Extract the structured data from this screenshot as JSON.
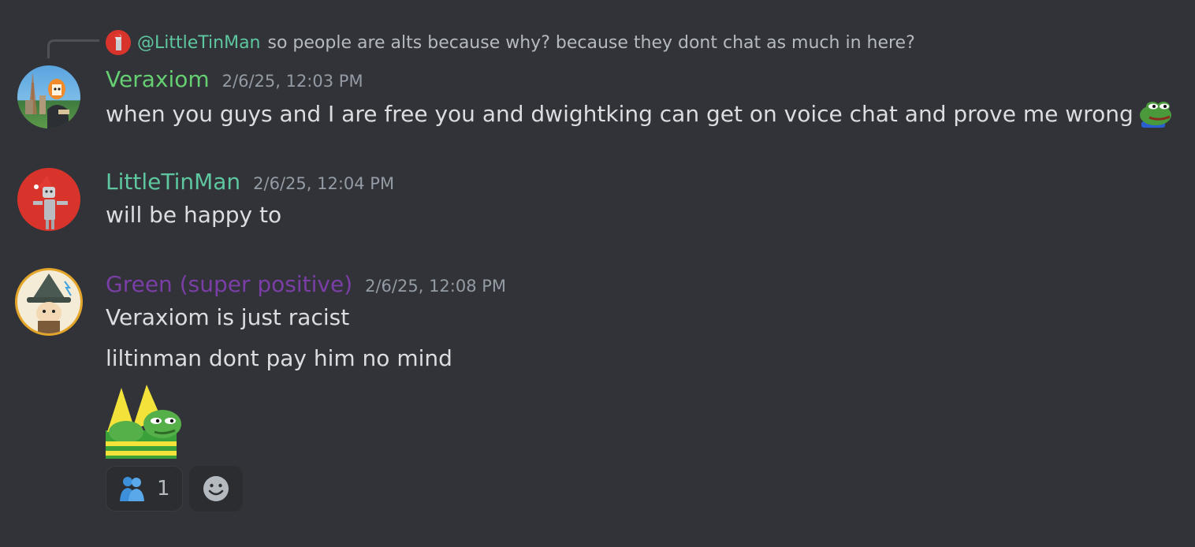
{
  "reply": {
    "mention": "@LittleTinMan",
    "text": "so people are alts because why? because they dont chat as much in here?"
  },
  "messages": [
    {
      "author": "Veraxiom",
      "timestamp": "2/6/25, 12:03 PM",
      "lines": [
        "when you guys and I are free you and dwightking can get on voice chat and prove me wrong"
      ],
      "inline_emoji": "pepe-frog-emoji"
    },
    {
      "author": "LittleTinMan",
      "timestamp": "2/6/25, 12:04 PM",
      "lines": [
        "will be happy to"
      ]
    },
    {
      "author": "Green (super positive)",
      "timestamp": "2/6/25, 12:08 PM",
      "lines": [
        "Veraxiom is just racist",
        "liltinman dont pay him no mind"
      ],
      "emoji": "pepe-twins-emoji",
      "reactions": [
        {
          "emoji": "people-hugging-icon",
          "count": "1"
        }
      ],
      "add_reaction_icon": "smiley-face-icon"
    }
  ],
  "colors": {
    "background": "#313338",
    "veraxiom": "#65cf72",
    "littletinman": "#5ec79f",
    "green": "#7b3ea6",
    "timestamp": "#949ba4",
    "text": "#dbdee1"
  }
}
